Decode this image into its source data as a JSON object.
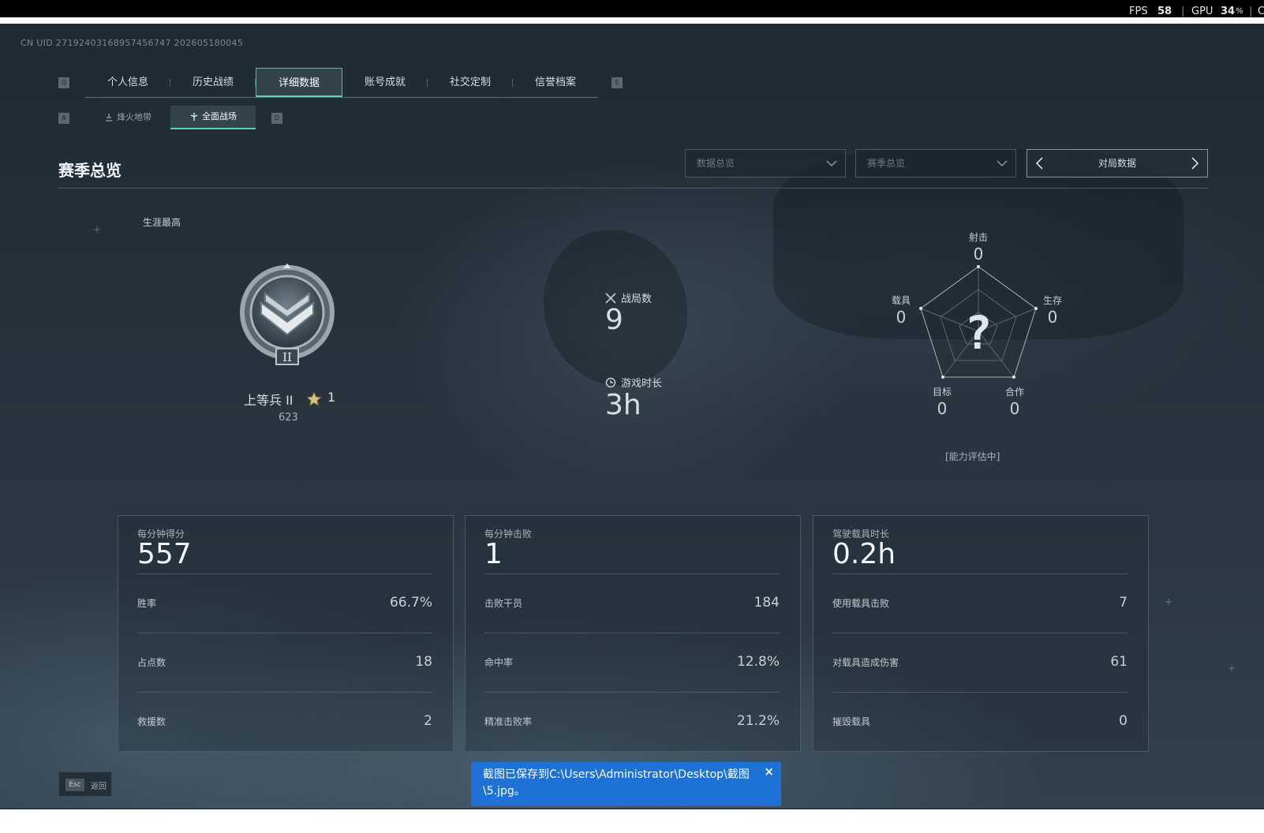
{
  "perf": {
    "fps_label": "FPS",
    "fps_value": "58",
    "gpu_label": "GPU",
    "gpu_value": "34",
    "gpu_unit": "%",
    "edge_char": "C"
  },
  "uid": "CN UID 27192403168957456747 202605180045",
  "tabs": [
    {
      "label": "个人信息",
      "key": "Q"
    },
    {
      "label": "历史战绩"
    },
    {
      "label": "详细数据",
      "active": true
    },
    {
      "label": "账号成就"
    },
    {
      "label": "社交定制"
    },
    {
      "label": "信誉档案",
      "key": "E"
    }
  ],
  "tab_keys": {
    "left": "Q",
    "right": "E"
  },
  "subtabs": [
    {
      "label": "烽火地带"
    },
    {
      "label": "全面战场",
      "active": true
    }
  ],
  "subtab_keys": {
    "left": "A",
    "right": "D"
  },
  "section_title": "赛季总览",
  "dropdowns": [
    {
      "placeholder": "数据总览"
    },
    {
      "placeholder": "赛季总览"
    }
  ],
  "pager": {
    "label": "对局数据"
  },
  "career": {
    "label": "生涯最高",
    "rank_name": "上等兵 II",
    "rank_badge": "II",
    "stars": "1",
    "points": "623"
  },
  "summary": {
    "matches_label": "战局数",
    "matches_value": "9",
    "time_label": "游戏时长",
    "time_value": "3h"
  },
  "radar": {
    "shooting": {
      "label": "射击",
      "value": "0"
    },
    "survival": {
      "label": "生存",
      "value": "0"
    },
    "cooperation": {
      "label": "合作",
      "value": "0"
    },
    "objective": {
      "label": "目标",
      "value": "0"
    },
    "vehicle": {
      "label": "载具",
      "value": "0"
    },
    "center": "?",
    "status": "[能力评估中]"
  },
  "panels": [
    {
      "head": "每分钟得分",
      "big": "557",
      "rows": [
        {
          "label": "胜率",
          "value": "66.7%"
        },
        {
          "label": "占点数",
          "value": "18"
        },
        {
          "label": "救援数",
          "value": "2"
        }
      ]
    },
    {
      "head": "每分钟击败",
      "big": "1",
      "rows": [
        {
          "label": "击败干员",
          "value": "184"
        },
        {
          "label": "命中率",
          "value": "12.8%"
        },
        {
          "label": "精准击败率",
          "value": "21.2%"
        }
      ]
    },
    {
      "head": "驾驶载具时长",
      "big": "0.2h",
      "rows": [
        {
          "label": "使用载具击败",
          "value": "7"
        },
        {
          "label": "对载具造成伤害",
          "value": "61"
        },
        {
          "label": "摧毁载具",
          "value": "0"
        }
      ]
    }
  ],
  "esc": {
    "key": "Esc",
    "label": "返回"
  },
  "toast": {
    "text": "截图已保存到C:\\Users\\Administrator\\Desktop\\截图\\5.jpg。",
    "close": "×"
  },
  "colors": {
    "accent": "#5fd1b8",
    "toast": "#1e72d6"
  }
}
